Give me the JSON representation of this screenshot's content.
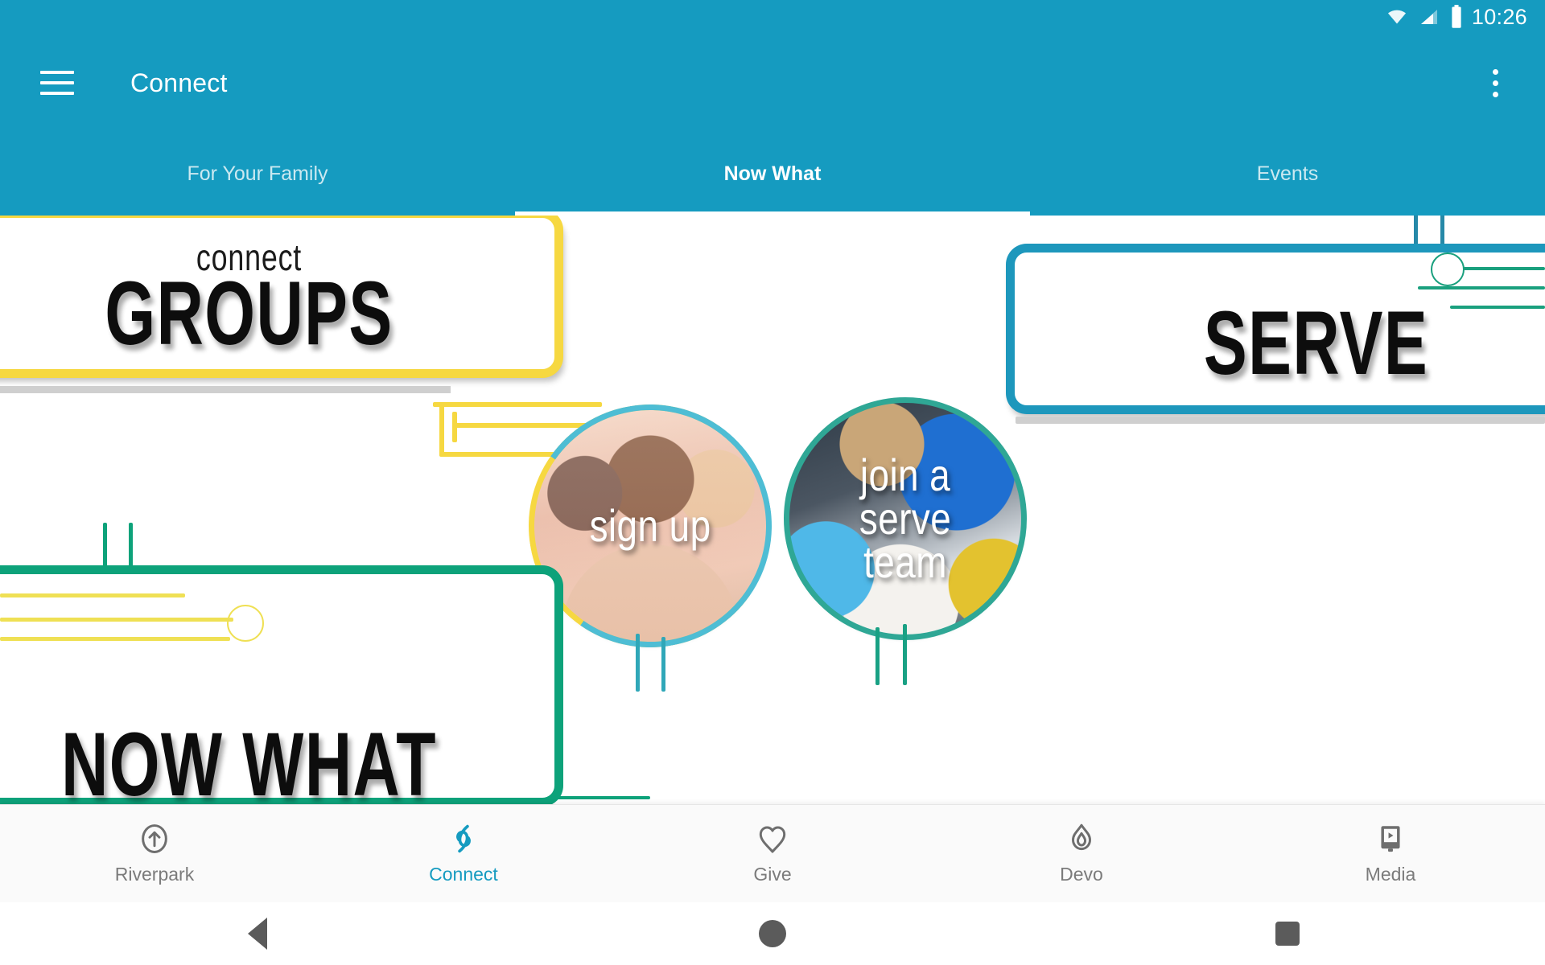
{
  "status_bar": {
    "time": "10:26",
    "icons": [
      "wifi-icon",
      "cell-signal-icon",
      "battery-icon"
    ]
  },
  "app_bar": {
    "menu_icon": "hamburger-menu-icon",
    "title": "Connect",
    "overflow_icon": "more-vertical-icon"
  },
  "tabs": [
    {
      "label": "For Your Family",
      "active": false
    },
    {
      "label": "Now What",
      "active": true
    },
    {
      "label": "Events",
      "active": false
    }
  ],
  "content": {
    "groups_card": {
      "kicker": "connect",
      "title": "GROUPS",
      "border_color": "#F6D841"
    },
    "serve_card": {
      "kicker": "",
      "title": "SERVE",
      "border_color": "#1D97BC"
    },
    "nowwhat_card": {
      "kicker": "",
      "title": "NOW WHAT",
      "border_color": "#0DA27A"
    },
    "signup_circle": {
      "caption": "sign up",
      "ring_colors": [
        "#F6D841",
        "#4EBDD4"
      ]
    },
    "serve_circle": {
      "caption_line1": "join a",
      "caption_line2": "serve team",
      "ring_color": "#2FA795"
    }
  },
  "bottom_nav": [
    {
      "label": "Riverpark",
      "icon": "arrow-up-circle-icon",
      "active": false
    },
    {
      "label": "Connect",
      "icon": "link-loop-icon",
      "active": true
    },
    {
      "label": "Give",
      "icon": "heart-icon",
      "active": false
    },
    {
      "label": "Devo",
      "icon": "flame-icon",
      "active": false
    },
    {
      "label": "Media",
      "icon": "media-play-icon",
      "active": false
    }
  ],
  "system_nav": [
    {
      "label": "Back",
      "icon": "triangle-back-icon"
    },
    {
      "label": "Home",
      "icon": "circle-home-icon"
    },
    {
      "label": "Recent",
      "icon": "square-recents-icon"
    }
  ],
  "colors": {
    "brand_teal": "#159BC0",
    "yellow": "#F6D841",
    "green": "#0DA27A",
    "blue": "#1D97BC"
  }
}
